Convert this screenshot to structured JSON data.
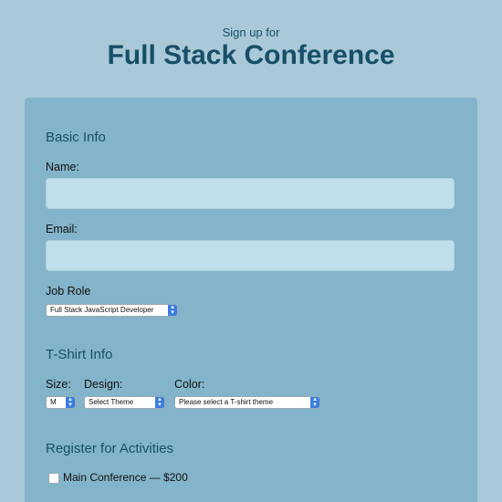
{
  "header": {
    "subtitle": "Sign up for",
    "title": "Full Stack Conference"
  },
  "basic_info": {
    "heading": "Basic Info",
    "name_label": "Name:",
    "name_value": "",
    "email_label": "Email:",
    "email_value": "",
    "job_role_label": "Job Role",
    "job_role_selected": "Full Stack JavaScript Developer"
  },
  "tshirt_info": {
    "heading": "T-Shirt Info",
    "size_label": "Size:",
    "size_selected": "M",
    "design_label": "Design:",
    "design_selected": "Select Theme",
    "color_label": "Color:",
    "color_selected": "Please select a T-shirt theme"
  },
  "activities": {
    "heading": "Register for Activities",
    "items": [
      {
        "label": "Main Conference — $200",
        "checked": false
      }
    ]
  },
  "colors": {
    "page_background": "#a9c9d8",
    "card_background": "#83b4ca",
    "heading_color": "#184f68",
    "input_background": "#c1dfeb",
    "select_arrow": "#3b7de0"
  }
}
